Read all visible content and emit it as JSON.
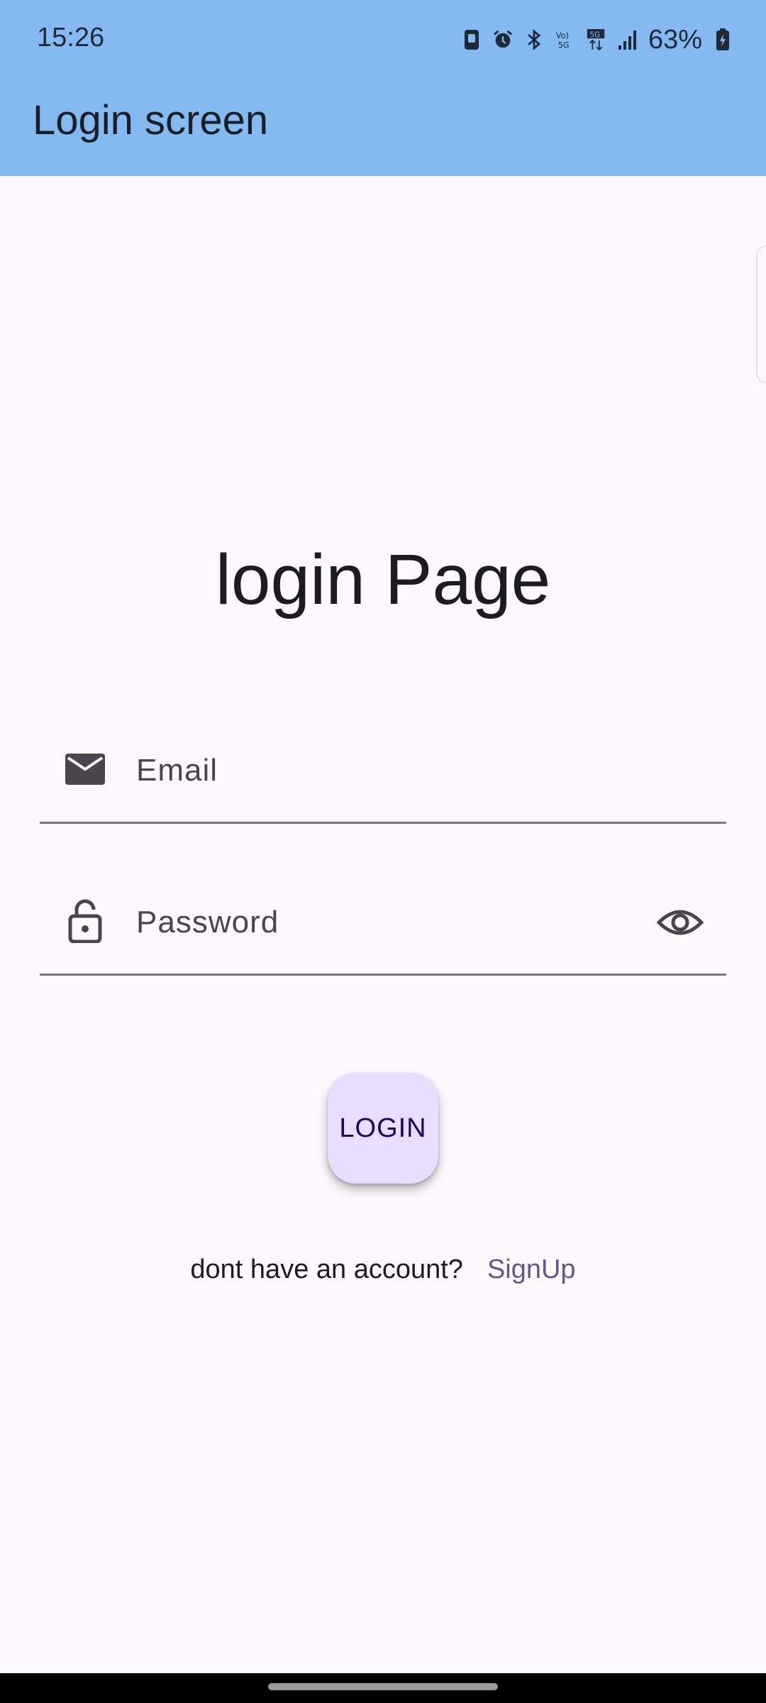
{
  "status_bar": {
    "time": "15:26",
    "battery_percent": "63%",
    "icons": [
      "save-icon",
      "alarm-icon",
      "bluetooth-icon",
      "volte-icon",
      "5g-icon",
      "signal-icon",
      "battery-charging-icon"
    ]
  },
  "app_bar": {
    "title": "Login screen",
    "color": "#84b9f2"
  },
  "main": {
    "heading": "login Page",
    "email_field": {
      "placeholder": "Email",
      "value": "",
      "icon": "email-icon"
    },
    "password_field": {
      "placeholder": "Password",
      "value": "",
      "icon": "lock-icon",
      "toggle_icon": "visibility-icon"
    },
    "login_button": {
      "label": "LOGIN",
      "color": "#e9ddff"
    },
    "signup": {
      "prompt": "dont have an account?",
      "link_label": "SignUp",
      "link_color": "#65558f"
    }
  }
}
